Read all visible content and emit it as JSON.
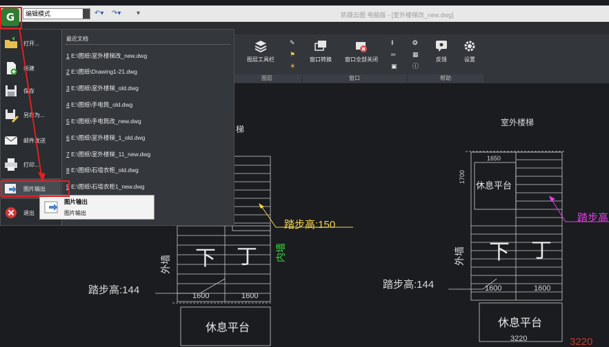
{
  "app": {
    "window_title": "凯薇云图 电脑版 - [室外楼梯改_new.dwg]",
    "logo_letter": "G",
    "mode_select_value": "编辑模式"
  },
  "ribbon": {
    "tools": [
      {
        "label": "图层工具栏"
      },
      {
        "label": "窗口转换"
      },
      {
        "label": "窗口全部关闭"
      },
      {
        "label": "反馈"
      },
      {
        "label": "设置"
      }
    ],
    "groups": [
      {
        "label": "图层"
      },
      {
        "label": "窗口"
      },
      {
        "label": "帮助"
      }
    ]
  },
  "app_menu": {
    "items": [
      {
        "label": "打开..."
      },
      {
        "label": "新建"
      },
      {
        "label": "保存"
      },
      {
        "label": "另存为..."
      },
      {
        "label": "邮件发送"
      },
      {
        "label": "打印..."
      },
      {
        "label": "图片输出"
      },
      {
        "label": "退出"
      }
    ],
    "recent_title": "最近文档",
    "recent_files": [
      {
        "num": "1",
        "path": "E:\\图纸\\室外楼梯改_new.dwg"
      },
      {
        "num": "2",
        "path": "E:\\图纸\\Drawing1-21.dwg"
      },
      {
        "num": "3",
        "path": "E:\\图纸\\室外楼梯_old.dwg"
      },
      {
        "num": "4",
        "path": "E:\\图纸\\手电筒_old.dwg"
      },
      {
        "num": "5",
        "path": "E:\\图纸\\手电筒改_new.dwg"
      },
      {
        "num": "6",
        "path": "E:\\图纸\\室外楼梯_1_old.dwg"
      },
      {
        "num": "7",
        "path": "E:\\图纸\\室外楼梯_11_new.dwg"
      },
      {
        "num": "8",
        "path": "E:\\图纸\\石墙衣柜_old.dwg"
      },
      {
        "num": "9",
        "path": "E:\\图纸\\石墙衣柜1_new.dwg"
      }
    ],
    "tooltip": {
      "title": "图片输出",
      "description": "图片输出"
    }
  },
  "drawing": {
    "labels": {
      "stair_title_left": "梯",
      "stair_title_right": "室外楼梯",
      "step_height_150": "踏步高:150",
      "step_height_144_left": "踏步高:144",
      "step_height_144_right": "踏步高:144",
      "step_height_right_edge": "踏步高",
      "inner_wall": "内墙",
      "outer_wall_left": "外墙",
      "outer_wall_right": "外墙",
      "down_left": "下",
      "up_left": "丁",
      "down_right": "下",
      "up_right": "丁",
      "landing_bottom_left": "休息平台",
      "landing_top_right": "休息平台",
      "landing_bottom_right": "休息平台",
      "dim_1600_a": "1600",
      "dim_1600_b": "1600",
      "dim_1600_c": "1600",
      "dim_1600_d": "1600",
      "dim_1650": "1650",
      "dim_3220": "3220",
      "dim_3220_red": "3220",
      "dim_1700": "1700"
    }
  },
  "colors": {
    "highlight_red": "#e02020",
    "yellow_text": "#f2d44a",
    "green_text": "#3ddc3d",
    "magenta_text": "#e040e0"
  }
}
